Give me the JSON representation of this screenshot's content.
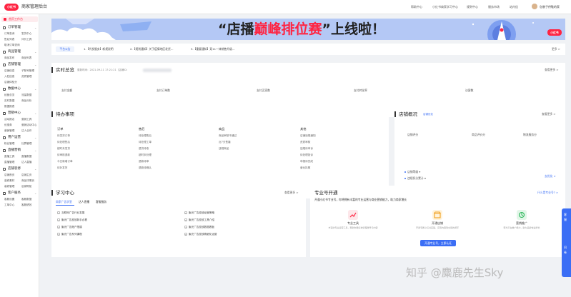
{
  "header": {
    "logo_text": "小红书",
    "brand": "商家管理后台",
    "links": [
      "帮助中心",
      "小红书商家学习中心",
      "规则中心",
      "服务市场",
      "站内信"
    ],
    "user": "包装子供鞋的家"
  },
  "sidebar": {
    "home": "首页工作台",
    "sections": [
      {
        "title": "订单管理",
        "items": [
          "订单查询",
          "发货中心",
          "售后列表",
          "评价工具",
          "取消订单查询"
        ]
      },
      {
        "title": "商品管理",
        "items": [
          "商品发布",
          "商品列表"
        ]
      },
      {
        "title": "店铺管理",
        "items": [
          "店铺信息",
          "子账号管理",
          "入驻信息",
          "资质管理",
          "店铺体验分"
        ]
      },
      {
        "title": "数据中心",
        "items": [
          "经营总览",
          "流量数据",
          "实时数据",
          "商品分析",
          "数据报表"
        ]
      },
      {
        "title": "营销中心",
        "items": [
          "活动报名",
          "营销工具",
          "优惠券",
          "营销活动中心",
          "营销管理",
          "达人合作"
        ]
      },
      {
        "title": "用户运营",
        "items": [
          "粉丝管理",
          "社群管理"
        ]
      },
      {
        "title": "直播营销",
        "items": [
          "直播工具",
          "直播数据",
          "直播管理",
          "达人直播"
        ]
      },
      {
        "title": "店铺装修",
        "items": [
          "店铺首页",
          "店铺主页",
          "装修素材",
          "商品详情页",
          "装修管理",
          "店铺导航"
        ]
      },
      {
        "title": "客户服务",
        "items": [
          "客服设置",
          "客服数据",
          "工单中心",
          "客服绩效"
        ]
      }
    ]
  },
  "banner": {
    "title_pre": "“店播",
    "title_hi": "巅峰排位赛",
    "title_post": "”上线啦！",
    "logo": "小红书"
  },
  "notice": {
    "tag": "平台公告",
    "items": [
      "1.【代发服务】新规说明",
      "2.【规则通知】关于疫情地区发货…",
      "3.【重要通知】双11一体销售升级…"
    ],
    "more": "更多 >"
  },
  "realtime": {
    "title": "实时总览",
    "updated": "更新时间：2021-09-11 17:21:21（店铺ID：",
    "more": "查看更多 >",
    "metrics": [
      "支付金额",
      "支付订单数",
      "支付买家数",
      "支付转化率",
      "访客数"
    ]
  },
  "todo": {
    "title": "待办事项",
    "columns": [
      {
        "name": "订单",
        "items": [
          "待发货订单",
          "待处理售后",
          "超时未发货",
          "待审核退款",
          "今日新增订单",
          "待补发货"
        ]
      },
      {
        "name": "售后",
        "items": [
          "待处理售后",
          "待处理工单",
          "退货待收",
          "超时未处理",
          "退款待审",
          "退款待确认"
        ]
      },
      {
        "name": "商品",
        "items": [
          "商品审核不通过",
          "近7天售罄",
          "违规商品"
        ]
      },
      {
        "name": "其他",
        "items": [
          "店铺违规通知",
          "资质审核",
          "违规待申诉",
          "待处理投诉",
          "申报待完成",
          "营业执照"
        ]
      }
    ]
  },
  "shop": {
    "title": "店铺概况",
    "subtitle": "店铺优化",
    "more": "查看更多 >",
    "metrics": [
      "店铺评分",
      "商品评价分",
      "物流服务分"
    ],
    "rows": [
      "店铺等级",
      "违规扣分累计"
    ],
    "link": "去优化 >"
  },
  "learn": {
    "title": "学习中心",
    "more": "查看更多 >",
    "tabs": [
      "商家广告学堂",
      "达人直播",
      "客服服务"
    ],
    "items": [
      "互联网广告行业发展",
      "聚光广告投放新手必看",
      "聚光广告账户搭建",
      "聚光广告系列课程",
      "聚光广告投放经营策略",
      "聚光广告投放工具介绍",
      "聚光广告投放数据看板",
      "聚光广告投放精细化运营"
    ]
  },
  "pro": {
    "title": "专业号开通",
    "desc": "开通小红书专业号，你将拥有丰富的专业运营与商业营销能力，助力商家增长",
    "more": "什么是专业号? >",
    "features": [
      {
        "name": "专业工具",
        "desc": "丰富的专业运营工具，帮助你更好地管理账号与内容"
      },
      {
        "name": "开通店铺",
        "desc": "开通专属小红书店铺，实现内容到交易的闭环"
      },
      {
        "name": "营销推广",
        "desc": "聚光平台推广能力，助力品牌快速增长"
      }
    ],
    "button": "开通专业号，立即认证"
  },
  "float_tabs": [
    "联系客服",
    "问卷调查"
  ],
  "watermark": "知乎 @麋鹿先生Sky"
}
